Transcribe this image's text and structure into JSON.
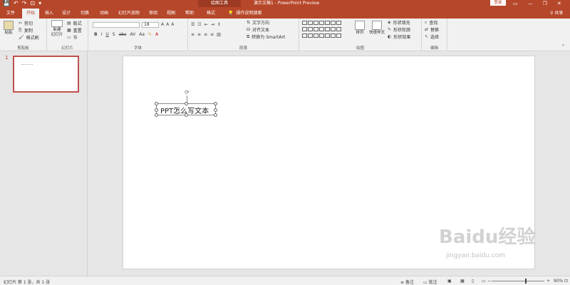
{
  "titlebar": {
    "context_tools": "绘图工具",
    "doc_title": "演示文稿1  -  PowerPoint Preview",
    "login": "登录",
    "qat": [
      "💾",
      "↶",
      "↷",
      "⊡",
      "▾"
    ],
    "window_controls": [
      "▭",
      "—",
      "❐",
      "✕"
    ]
  },
  "tabs": [
    {
      "label": "文件"
    },
    {
      "label": "开始"
    },
    {
      "label": "插入"
    },
    {
      "label": "设计"
    },
    {
      "label": "切换"
    },
    {
      "label": "动画"
    },
    {
      "label": "幻灯片放映"
    },
    {
      "label": "审阅"
    },
    {
      "label": "视图"
    },
    {
      "label": "帮助"
    },
    {
      "label": "格式"
    }
  ],
  "tell_me": "操作说明搜索",
  "share": "共享",
  "ribbon": {
    "clipboard": {
      "paste": "粘贴",
      "cut": "剪切",
      "copy": "复制",
      "format_painter": "格式刷",
      "label": "剪贴板"
    },
    "slides": {
      "new_slide": "新建",
      "new_slide2": "幻灯片",
      "layout": "版式",
      "reset": "重置",
      "section": "节",
      "label": "幻灯片"
    },
    "font": {
      "font_name": "",
      "font_size": "18",
      "bold": "B",
      "italic": "I",
      "underline": "U",
      "shadow": "S",
      "strike": "abc",
      "spacing": "AV",
      "case": "Aa",
      "grow": "A",
      "shrink": "A",
      "clear": "A",
      "label": "字体"
    },
    "paragraph": {
      "text_direction": "文字方向",
      "align_text": "对齐文本",
      "smartart": "转换为 SmartArt",
      "label": "段落"
    },
    "drawing": {
      "arrange": "排列",
      "quick_styles": "快速样式",
      "fill": "形状填充",
      "outline": "形状轮廓",
      "effects": "形状效果",
      "label": "绘图"
    },
    "editing": {
      "find": "查找",
      "replace": "替换",
      "select": "选择",
      "label": "编辑"
    }
  },
  "thumbnails": [
    {
      "number": "1"
    }
  ],
  "slide": {
    "textbox_text": "PPT怎么写文本"
  },
  "watermark": {
    "logo": "Baidu经验",
    "url": "jingyan.baidu.com"
  },
  "status": {
    "slide_info": "幻灯片 第 1 张，共 1 张",
    "notes": "备注",
    "comments": "批注",
    "zoom": "90%"
  }
}
